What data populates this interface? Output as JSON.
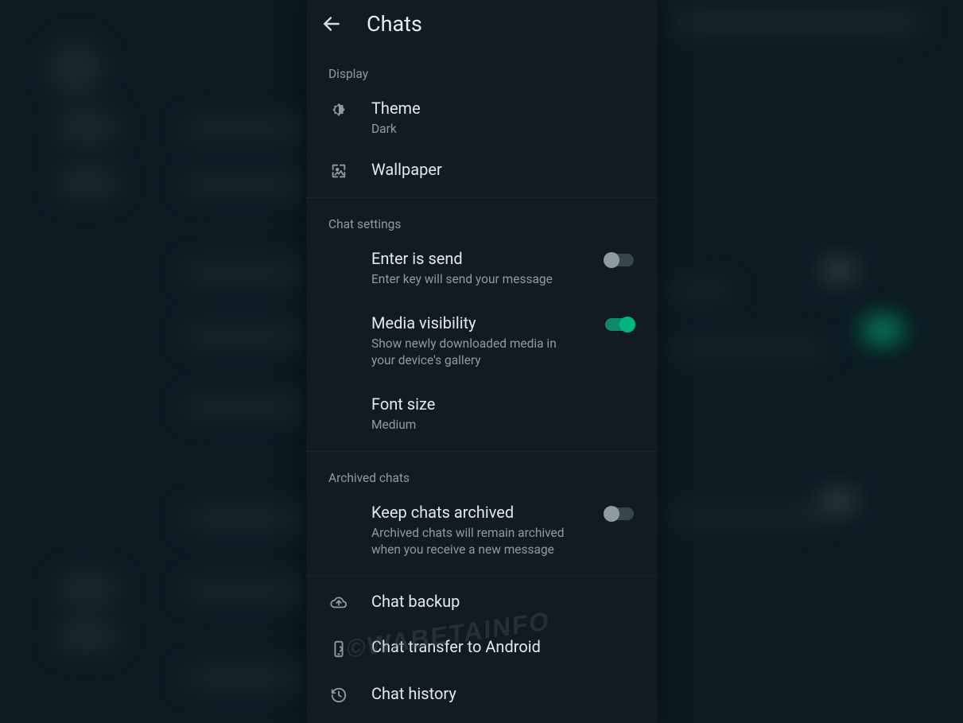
{
  "header": {
    "title": "Chats"
  },
  "sections": {
    "display": {
      "header": "Display",
      "theme": {
        "label": "Theme",
        "value": "Dark"
      },
      "wallpaper": {
        "label": "Wallpaper"
      }
    },
    "chat_settings": {
      "header": "Chat settings",
      "enter_send": {
        "label": "Enter is send",
        "sub": "Enter key will send your message",
        "on": false
      },
      "media_vis": {
        "label": "Media visibility",
        "sub": "Show newly downloaded media in your device's gallery",
        "on": true
      },
      "font_size": {
        "label": "Font size",
        "value": "Medium"
      }
    },
    "archived": {
      "header": "Archived chats",
      "keep_archived": {
        "label": "Keep chats archived",
        "sub": "Archived chats will remain archived when you receive a new message",
        "on": false
      }
    },
    "other": {
      "backup": {
        "label": "Chat backup"
      },
      "transfer": {
        "label": "Chat transfer to Android"
      },
      "history": {
        "label": "Chat history"
      }
    }
  },
  "watermark": "©WABETAINFO"
}
